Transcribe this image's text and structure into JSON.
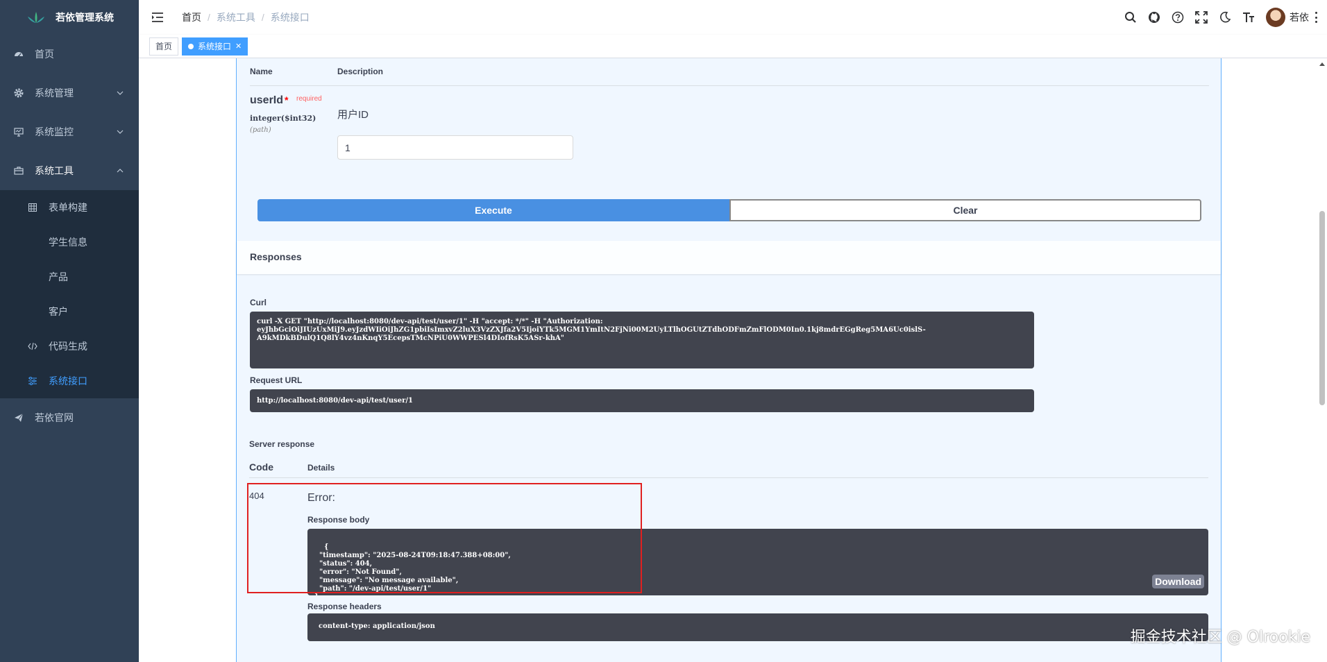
{
  "sidebar": {
    "title": "若依管理系统",
    "items": [
      {
        "label": "首页",
        "icon": "dashboard-icon"
      },
      {
        "label": "系统管理",
        "icon": "gear-icon"
      },
      {
        "label": "系统监控",
        "icon": "monitor-icon"
      },
      {
        "label": "系统工具",
        "icon": "toolbox-icon"
      }
    ],
    "tool_children": [
      {
        "label": "表单构建",
        "icon": "table-icon"
      },
      {
        "label": "学生信息"
      },
      {
        "label": "产品"
      },
      {
        "label": "客户"
      },
      {
        "label": "代码生成",
        "icon": "code-icon"
      },
      {
        "label": "系统接口",
        "icon": "sliders-icon",
        "active": true
      }
    ],
    "external": {
      "label": "若依官网",
      "icon": "send-icon"
    }
  },
  "navbar": {
    "breadcrumb": [
      "首页",
      "系统工具",
      "系统接口"
    ],
    "user_name": "若依"
  },
  "tags": [
    {
      "label": "首页"
    },
    {
      "label": "系统接口",
      "active": true
    }
  ],
  "swagger": {
    "param_header": {
      "name": "Name",
      "description": "Description"
    },
    "param": {
      "name": "userId",
      "star": "*",
      "required": "required",
      "type": "integer($int32)",
      "in": "(path)",
      "description": "用户ID",
      "value": "1"
    },
    "execute_label": "Execute",
    "clear_label": "Clear",
    "responses_title": "Responses",
    "curl_label": "Curl",
    "curl_text": "curl -X GET \"http://localhost:8080/dev-api/test/user/1\" -H \"accept: */*\" -H \"Authorization: \neyJhbGciOiJIUzUxMiJ9.eyJzdWIiOiJhZG1pbiIsImxvZ2luX3VzZXJfa2V5IjoiYTk5MGM1YmItN2FjNi00M2UyLTlhOGUtZTdhODFmZmFlODM0In0.1kj8mdrEGgReg5MA6Uc0islS-\nA9kMDkBDulQ1Q8lY4vz4nKnqY5EcepsTMcNPiU0WWPESl4DIofRsK5ASr-khA\"",
    "request_url_label": "Request URL",
    "request_url": "http://localhost:8080/dev-api/test/user/1",
    "server_response_label": "Server response",
    "code_header": "Code",
    "details_header": "Details",
    "status_code": "404",
    "error_title": "Error:",
    "response_body_label": "Response body",
    "response_body": "{\n  \"timestamp\": \"2025-08-24T09:18:47.388+08:00\",\n  \"status\": 404,\n  \"error\": \"Not Found\",\n  \"message\": \"No message available\",\n  \"path\": \"/dev-api/test/user/1\"\n}",
    "download_label": "Download",
    "response_headers_label": "Response headers",
    "response_headers": "content-type: application/json"
  },
  "watermark": "掘金技术社区 @ Olrookie",
  "colors": {
    "sidebar_bg": "#304156",
    "submenu_bg": "#1f2d3d",
    "active": "#409eff",
    "execute": "#4990e2",
    "highlight": "#e02020"
  }
}
